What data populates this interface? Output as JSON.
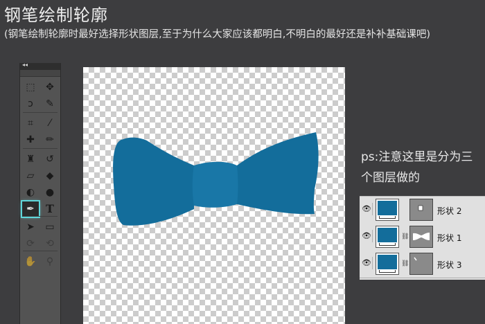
{
  "header": {
    "title": "钢笔绘制轮廓",
    "subtitle": "(钢笔绘制轮廓时最好选择形状图层,至于为什么大家应该都明白,不明白的最好还是补补基础课吧)"
  },
  "toolbox": {
    "collapse_glyph": "◂◂",
    "tools": [
      {
        "name": "marquee-tool-icon",
        "glyph": "⬚"
      },
      {
        "name": "move-tool-icon",
        "glyph": "✥"
      },
      {
        "name": "lasso-tool-icon",
        "glyph": "ↄ"
      },
      {
        "name": "quick-selection-tool-icon",
        "glyph": "✎"
      },
      {
        "name": "crop-tool-icon",
        "glyph": "⌗"
      },
      {
        "name": "eyedropper-tool-icon",
        "glyph": "⁄"
      },
      {
        "name": "healing-brush-tool-icon",
        "glyph": "✚"
      },
      {
        "name": "brush-tool-icon",
        "glyph": "✏"
      },
      {
        "name": "clone-stamp-tool-icon",
        "glyph": "♜"
      },
      {
        "name": "history-brush-tool-icon",
        "glyph": "↺"
      },
      {
        "name": "eraser-tool-icon",
        "glyph": "▱"
      },
      {
        "name": "paint-bucket-tool-icon",
        "glyph": "◆"
      },
      {
        "name": "blur-tool-icon",
        "glyph": "◐"
      },
      {
        "name": "dodge-tool-icon",
        "glyph": "●"
      },
      {
        "name": "pen-tool-icon",
        "glyph": "✒"
      },
      {
        "name": "type-tool-icon",
        "glyph": "T"
      },
      {
        "name": "path-selection-tool-icon",
        "glyph": "➤"
      },
      {
        "name": "shape-tool-icon",
        "glyph": "▭"
      },
      {
        "name": "3d-rotate-tool-icon",
        "glyph": "⟳"
      },
      {
        "name": "3d-orbit-tool-icon",
        "glyph": "⟲"
      },
      {
        "name": "hand-tool-icon",
        "glyph": "✋"
      },
      {
        "name": "zoom-tool-icon",
        "glyph": "⚲"
      }
    ],
    "active_tool": "pen-tool-icon"
  },
  "canvas": {
    "shape_color": "#136d9b",
    "knot_color": "#1977a7"
  },
  "note": {
    "line1": "ps:注意这里是分为三",
    "line2": "个图层做的"
  },
  "layers": [
    {
      "name": "形状 2",
      "mask": "knot"
    },
    {
      "name": "形状 1",
      "mask": "bow"
    },
    {
      "name": "形状 3",
      "mask": "line"
    }
  ]
}
